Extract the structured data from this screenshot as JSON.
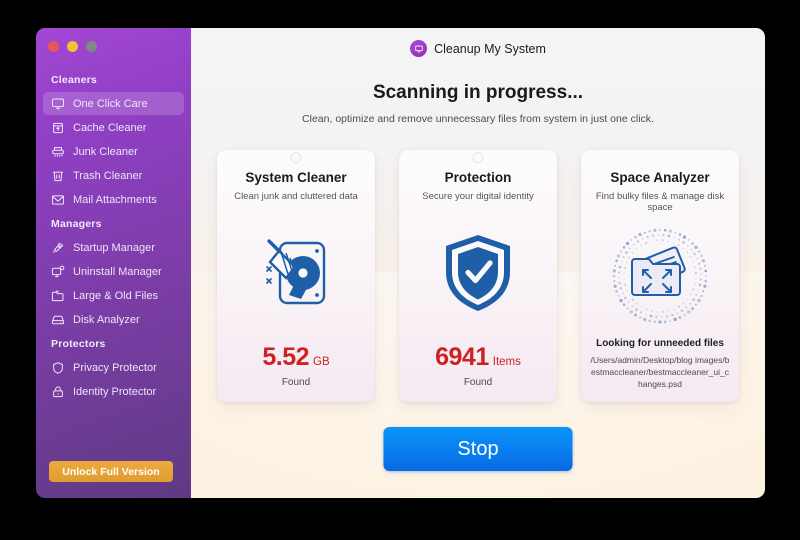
{
  "window": {
    "traffic_lights": [
      {
        "name": "close",
        "color": "#e8565b"
      },
      {
        "name": "minimize",
        "color": "#f2c038"
      },
      {
        "name": "maximize",
        "color": "#7f8a85"
      }
    ]
  },
  "brand": {
    "name": "Cleanup My System",
    "logo_icon": "monitor-icon",
    "logo_color": "#9a33c8"
  },
  "header": {
    "headline": "Scanning in progress...",
    "subhead": "Clean, optimize and remove unnecessary files from system in just one click."
  },
  "sidebar": {
    "unlock_label": "Unlock Full Version",
    "unlock_color": "#e5a235",
    "groups": [
      {
        "title": "Cleaners",
        "items": [
          {
            "label": "One Click Care",
            "icon": "monitor-icon",
            "active": true
          },
          {
            "label": "Cache Cleaner",
            "icon": "cache-box-icon",
            "active": false
          },
          {
            "label": "Junk Cleaner",
            "icon": "shredder-icon",
            "active": false
          },
          {
            "label": "Trash Cleaner",
            "icon": "trash-icon",
            "active": false
          },
          {
            "label": "Mail Attachments",
            "icon": "envelope-icon",
            "active": false
          }
        ]
      },
      {
        "title": "Managers",
        "items": [
          {
            "label": "Startup Manager",
            "icon": "rocket-icon",
            "active": false
          },
          {
            "label": "Uninstall Manager",
            "icon": "monitor-gear-icon",
            "active": false
          },
          {
            "label": "Large & Old Files",
            "icon": "folder-icon",
            "active": false
          },
          {
            "label": "Disk Analyzer",
            "icon": "hard-drive-icon",
            "active": false
          }
        ]
      },
      {
        "title": "Protectors",
        "items": [
          {
            "label": "Privacy Protector",
            "icon": "shield-icon",
            "active": false
          },
          {
            "label": "Identity Protector",
            "icon": "lock-icon",
            "active": false
          }
        ]
      }
    ]
  },
  "cards": [
    {
      "title": "System Cleaner",
      "subtitle": "Clean junk and cluttered data",
      "art_icon": "disk-broom-icon",
      "stat_value": "5.52",
      "stat_unit": "GB",
      "stat_caption": "Found",
      "stat_color": "#cf2121"
    },
    {
      "title": "Protection",
      "subtitle": "Secure your digital identity",
      "art_icon": "shield-check-icon",
      "stat_value": "6941",
      "stat_unit": "Items",
      "stat_caption": "Found",
      "stat_color": "#cf2121"
    },
    {
      "title": "Space Analyzer",
      "subtitle": "Find bulky files & manage disk space",
      "art_icon": "folder-expand-icon",
      "scan_status": "Looking for unneeded files",
      "scan_path": "/Users/admin/Desktop/blog images/bestmaccleaner/bestmaccleaner_ui_changes.psd"
    }
  ],
  "actions": {
    "stop_label": "Stop",
    "stop_color": "#0a7ff0"
  }
}
